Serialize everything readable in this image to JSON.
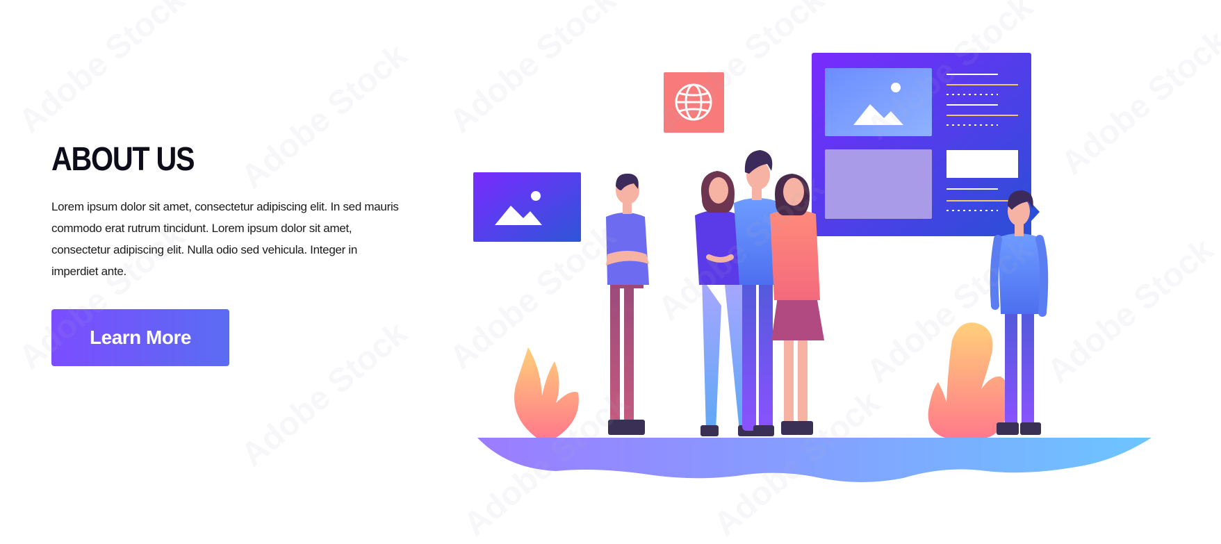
{
  "hero": {
    "title": "ABOUT US",
    "description": "Lorem ipsum dolor sit amet, consectetur adipiscing elit. In sed mauris commodo erat rutrum tincidunt. Lorem ipsum dolor sit amet, consectetur adipiscing elit. Nulla  odio sed vehicula. Integer in imperdiet ante.",
    "cta_label": "Learn More"
  },
  "watermark": "Adobe Stock",
  "colors": {
    "accent": "#6c5cf6",
    "title": "#0d0d1a",
    "coral": "#f97a7a",
    "sky": "#6aa8ff"
  },
  "illustration": {
    "icons": [
      "image-icon",
      "globe-icon",
      "image-icon"
    ],
    "people_count": 5
  }
}
